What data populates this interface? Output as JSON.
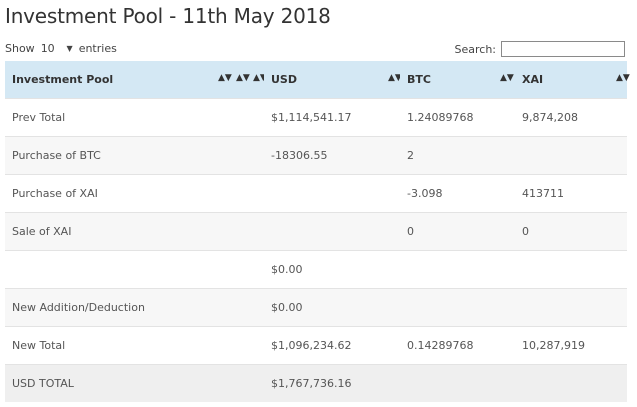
{
  "title": "Investment Pool - 11th May 2018",
  "length_control": {
    "show_label": "Show",
    "value": "10",
    "entries_label": "entries"
  },
  "search": {
    "label": "Search:",
    "value": ""
  },
  "table": {
    "headers": [
      "Investment Pool",
      "USD",
      "BTC",
      "XAI"
    ],
    "rows": [
      [
        "Prev Total",
        "$1,114,541.17",
        "1.24089768",
        "9,874,208"
      ],
      [
        "Purchase of BTC",
        "-18306.55",
        "2",
        ""
      ],
      [
        "Purchase of XAI",
        "",
        "-3.098",
        "413711"
      ],
      [
        "Sale of XAI",
        "",
        "0",
        "0"
      ],
      [
        "",
        "$0.00",
        "",
        ""
      ],
      [
        "New Addition/Deduction",
        "$0.00",
        "",
        ""
      ],
      [
        "New Total",
        "$1,096,234.62",
        "0.14289768",
        "10,287,919"
      ],
      [
        "USD TOTAL",
        "$1,767,736.16",
        "",
        ""
      ]
    ]
  }
}
